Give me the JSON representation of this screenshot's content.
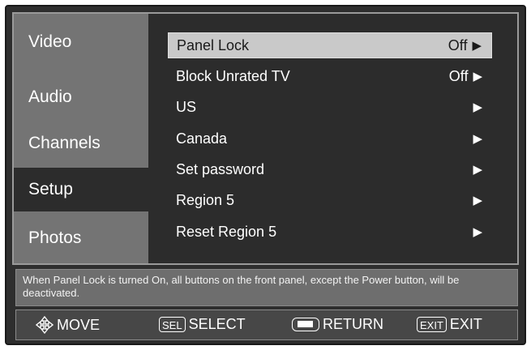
{
  "sidebar": {
    "items": [
      {
        "label": "Video",
        "active": false
      },
      {
        "label": "Audio",
        "active": false
      },
      {
        "label": "Channels",
        "active": false
      },
      {
        "label": "Setup",
        "active": true
      },
      {
        "label": "Photos",
        "active": false
      }
    ]
  },
  "menu": {
    "rows": [
      {
        "label": "Panel Lock",
        "value": "Off",
        "selected": true
      },
      {
        "label": "Block Unrated TV",
        "value": "Off",
        "selected": false
      },
      {
        "label": "US",
        "value": "",
        "selected": false
      },
      {
        "label": "Canada",
        "value": "",
        "selected": false
      },
      {
        "label": "Set password",
        "value": "",
        "selected": false
      },
      {
        "label": "Region 5",
        "value": "",
        "selected": false
      },
      {
        "label": "Reset Region 5",
        "value": "",
        "selected": false
      }
    ],
    "arrow": "▶"
  },
  "help": {
    "text": "When Panel Lock is turned On, all buttons on the front panel, except the Power button, will be deactivated."
  },
  "footer": {
    "move_icon": "move-arrows-icon",
    "move_label": "MOVE",
    "sel_key": "SEL",
    "select_label": "SELECT",
    "return_icon": "return-key-icon",
    "return_label": "RETURN",
    "exit_key": "EXIT",
    "exit_label": "EXIT"
  }
}
